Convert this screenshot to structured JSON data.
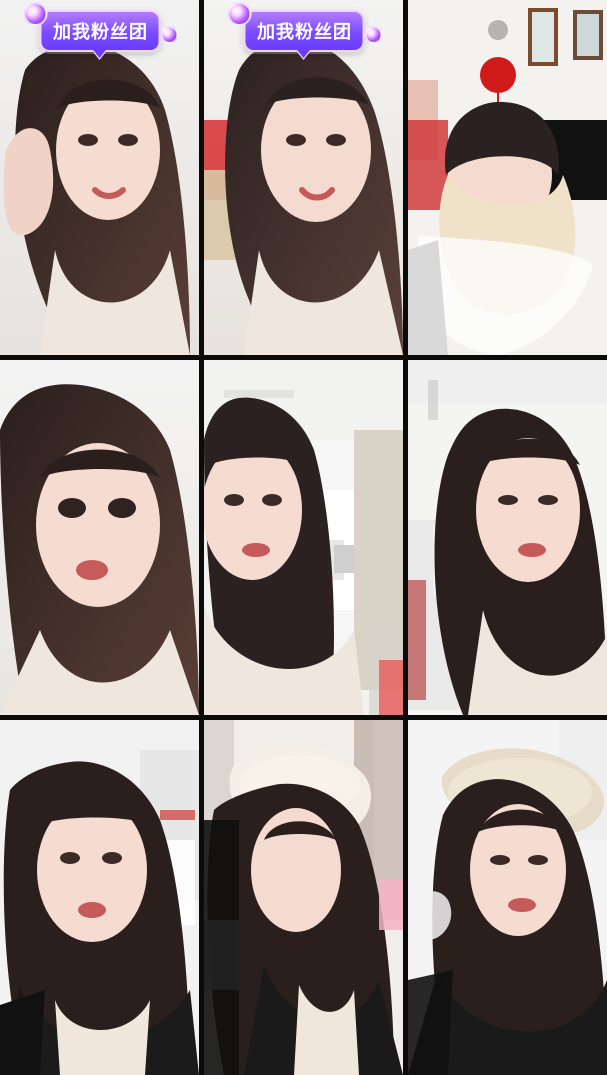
{
  "badges": [
    {
      "text": "加我粉丝团"
    },
    {
      "text": "加我粉丝团"
    }
  ],
  "tiles": [
    {
      "name": "video-tile-1"
    },
    {
      "name": "video-tile-2"
    },
    {
      "name": "video-tile-3"
    },
    {
      "name": "video-tile-4"
    },
    {
      "name": "video-tile-5"
    },
    {
      "name": "video-tile-6"
    },
    {
      "name": "video-tile-7"
    },
    {
      "name": "video-tile-8"
    },
    {
      "name": "video-tile-9"
    }
  ]
}
